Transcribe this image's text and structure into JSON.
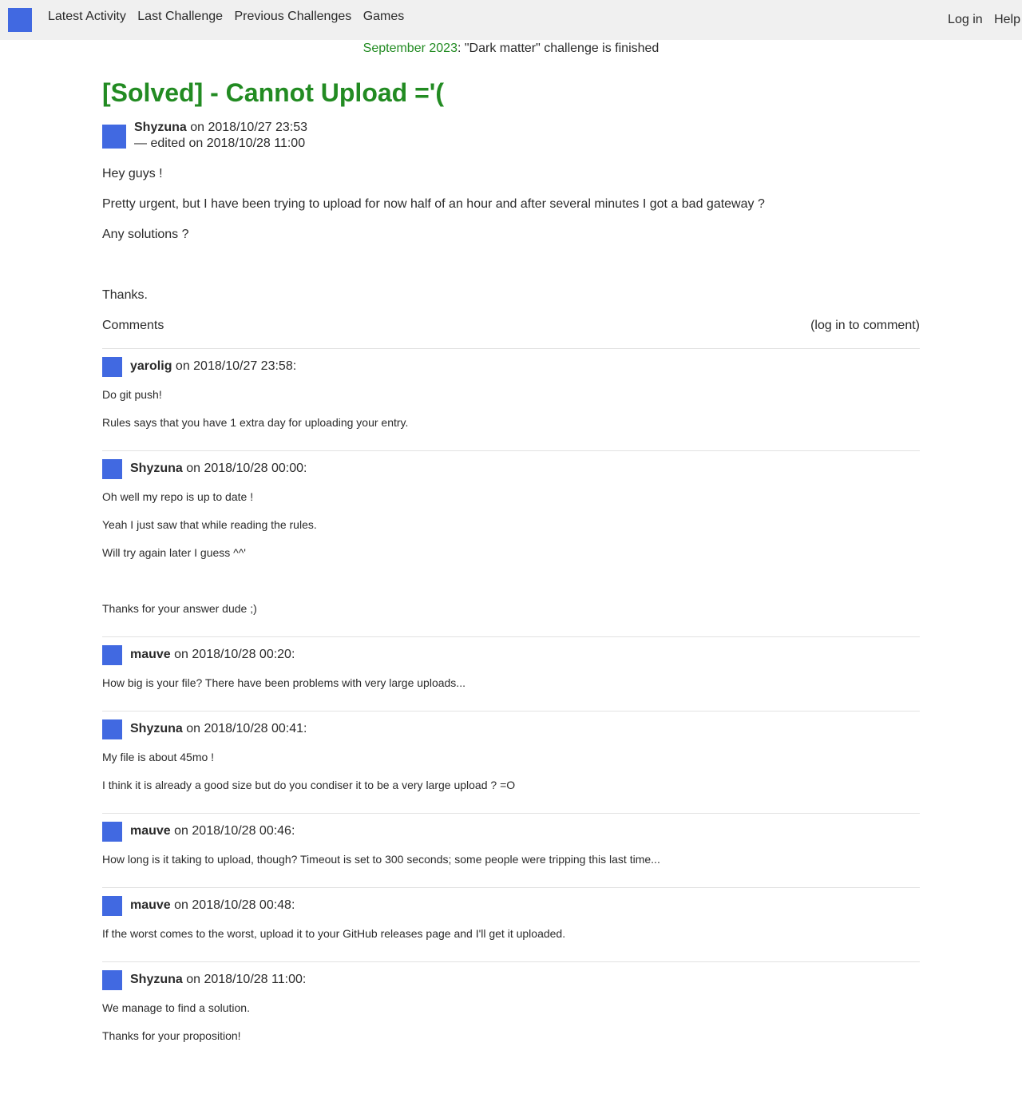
{
  "nav": {
    "links": [
      "Latest Activity",
      "Last Challenge",
      "Previous Challenges",
      "Games"
    ],
    "login": "Log in",
    "help": "Help"
  },
  "announcement": {
    "date": "September 2023",
    "text": ": \"Dark matter\" challenge is finished"
  },
  "post": {
    "title": "[Solved] - Cannot Upload ='(",
    "author": "Shyzuna",
    "posted": " on 2018/10/27 23:53",
    "edited": "— edited on 2018/10/28 11:00",
    "paragraphs": [
      "Hey guys !",
      "Pretty urgent, but I have been trying to upload for now half of an hour and after several minutes I got a bad gateway ?",
      "Any solutions ?",
      "",
      "Thanks."
    ]
  },
  "comments_header": {
    "label": "Comments",
    "action": "(log in to comment)"
  },
  "comments": [
    {
      "author": "yarolig",
      "when": " on 2018/10/27 23:58:",
      "paragraphs": [
        "Do git push!",
        "Rules says that you have 1 extra day for uploading your entry."
      ]
    },
    {
      "author": "Shyzuna",
      "when": " on 2018/10/28 00:00:",
      "paragraphs": [
        "Oh well my repo is up to date !",
        "Yeah I just saw that while reading the rules.",
        "Will try again later I guess ^^'",
        "",
        "Thanks for your answer dude ;)"
      ]
    },
    {
      "author": "mauve",
      "when": " on 2018/10/28 00:20:",
      "paragraphs": [
        "How big is your file? There have been problems with very large uploads..."
      ]
    },
    {
      "author": "Shyzuna",
      "when": " on 2018/10/28 00:41:",
      "paragraphs": [
        "My file is about 45mo !",
        "I think it is already a good size but do you condiser it to be a very large upload ? =O"
      ]
    },
    {
      "author": "mauve",
      "when": " on 2018/10/28 00:46:",
      "paragraphs": [
        "How long is it taking to upload, though? Timeout is set to 300 seconds; some people were tripping this last time..."
      ]
    },
    {
      "author": "mauve",
      "when": " on 2018/10/28 00:48:",
      "paragraphs": [
        "If the worst comes to the worst, upload it to your GitHub releases page and I'll get it uploaded."
      ]
    },
    {
      "author": "Shyzuna",
      "when": " on 2018/10/28 11:00:",
      "paragraphs": [
        "We manage to find a solution.",
        "Thanks for your proposition!"
      ]
    }
  ],
  "colors": {
    "accent": "#228b22",
    "avatar": "#4169e1",
    "topbar": "#f0f0f0"
  }
}
